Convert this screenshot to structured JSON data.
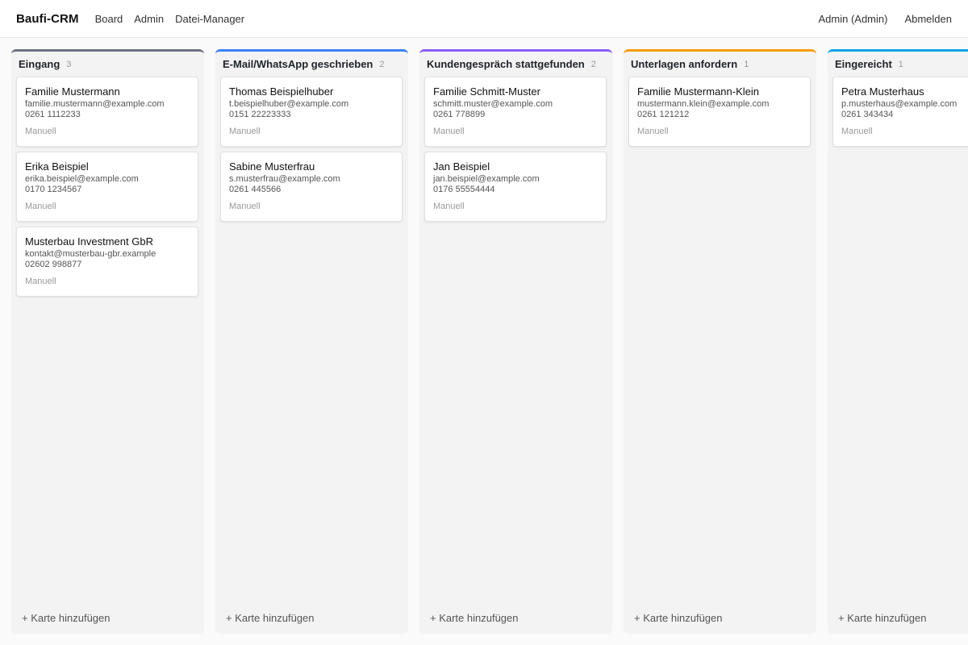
{
  "app": {
    "title": "Baufi-CRM",
    "nav": [
      "Board",
      "Admin",
      "Datei-Manager"
    ],
    "user": "Admin (Admin)",
    "logout": "Abmelden"
  },
  "board": {
    "add_label": "+ Karte hinzufügen",
    "columns": [
      {
        "title": "Eingang",
        "count": "3",
        "color": "#6b7280",
        "cards": [
          {
            "name": "Familie Mustermann",
            "email": "familie.mustermann@example.com",
            "phone": "0261 1112233",
            "source": "Manuell"
          },
          {
            "name": "Erika Beispiel",
            "email": "erika.beispiel@example.com",
            "phone": "0170 1234567",
            "source": "Manuell"
          },
          {
            "name": "Musterbau Investment GbR",
            "email": "kontakt@musterbau-gbr.example",
            "phone": "02602 998877",
            "source": "Manuell"
          }
        ]
      },
      {
        "title": "E-Mail/WhatsApp geschrieben",
        "count": "2",
        "color": "#3b82f6",
        "cards": [
          {
            "name": "Thomas Beispielhuber",
            "email": "t.beispielhuber@example.com",
            "phone": "0151 22223333",
            "source": "Manuell"
          },
          {
            "name": "Sabine Musterfrau",
            "email": "s.musterfrau@example.com",
            "phone": "0261 445566",
            "source": "Manuell"
          }
        ]
      },
      {
        "title": "Kundengespräch stattgefunden",
        "count": "2",
        "color": "#8b5cf6",
        "cards": [
          {
            "name": "Familie Schmitt-Muster",
            "email": "schmitt.muster@example.com",
            "phone": "0261 778899",
            "source": "Manuell"
          },
          {
            "name": "Jan Beispiel",
            "email": "jan.beispiel@example.com",
            "phone": "0176 55554444",
            "source": "Manuell"
          }
        ]
      },
      {
        "title": "Unterlagen anfordern",
        "count": "1",
        "color": "#f59e0b",
        "cards": [
          {
            "name": "Familie Mustermann-Klein",
            "email": "mustermann.klein@example.com",
            "phone": "0261 121212",
            "source": "Manuell"
          }
        ]
      },
      {
        "title": "Eingereicht",
        "count": "1",
        "color": "#0ea5e9",
        "cards": [
          {
            "name": "Petra Musterhaus",
            "email": "p.musterhaus@example.com",
            "phone": "0261 343434",
            "source": "Manuell"
          }
        ]
      }
    ]
  }
}
